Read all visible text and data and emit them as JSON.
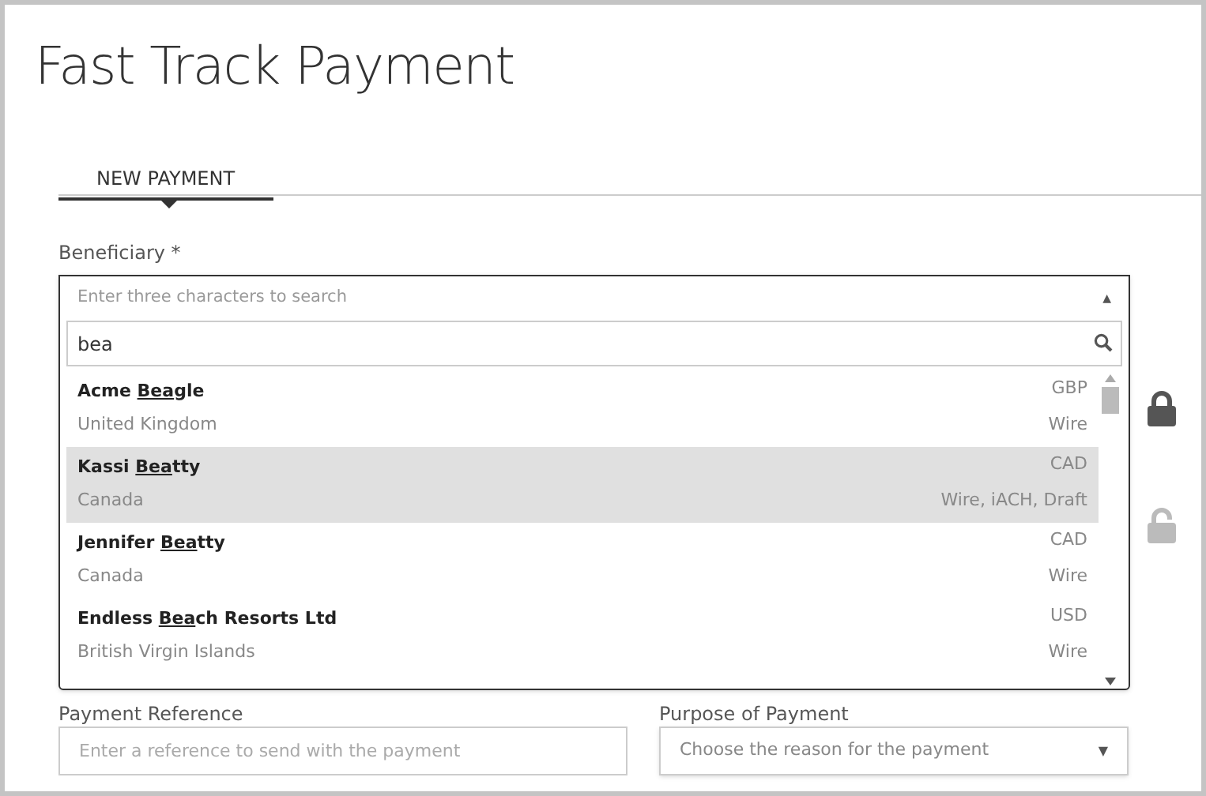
{
  "page": {
    "title": "Fast Track Payment"
  },
  "tabs": [
    {
      "label": "NEW PAYMENT",
      "selected": true
    }
  ],
  "beneficiary": {
    "label": "Beneficiary *",
    "placeholder": "Enter three characters to search",
    "expanded": true,
    "toggle": "▲",
    "search": {
      "value": "bea"
    },
    "results": [
      {
        "name_before": "Acme ",
        "name_match": "Bea",
        "name_after": "gle",
        "country": "United Kingdom",
        "currency": "GBP",
        "methods": "Wire",
        "selected": false
      },
      {
        "name_before": "Kassi ",
        "name_match": "Bea",
        "name_after": "tty",
        "country": "Canada",
        "currency": "CAD",
        "methods": "Wire, iACH, Draft",
        "selected": true
      },
      {
        "name_before": "Jennifer ",
        "name_match": "Bea",
        "name_after": "tty",
        "country": "Canada",
        "currency": "CAD",
        "methods": "Wire",
        "selected": false
      },
      {
        "name_before": "Endless ",
        "name_match": "Bea",
        "name_after": "ch Resorts Ltd",
        "country": "British Virgin Islands",
        "currency": "USD",
        "methods": "Wire",
        "selected": false
      }
    ]
  },
  "locks": [
    {
      "locked": true
    },
    {
      "locked": false
    }
  ],
  "payment_reference": {
    "label": "Payment Reference",
    "placeholder": "Enter a reference to send with the payment"
  },
  "purpose_of_payment": {
    "label": "Purpose of Payment",
    "placeholder": "Choose the reason for the payment",
    "toggle": "▼"
  }
}
